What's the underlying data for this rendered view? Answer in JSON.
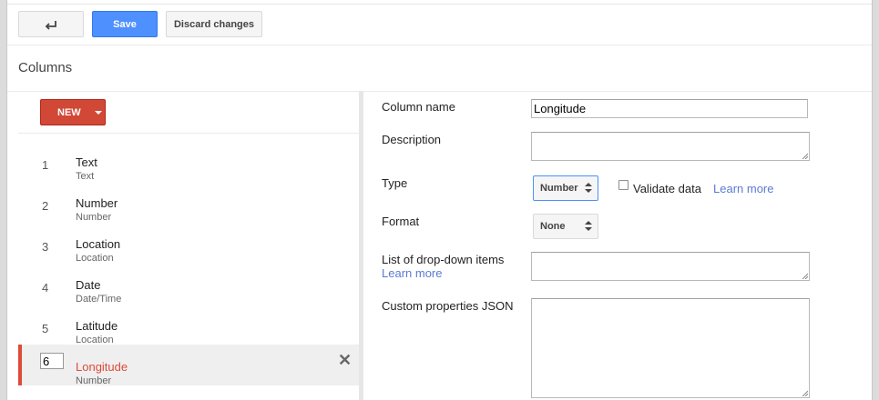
{
  "toolbar": {
    "back_icon": "back-arrow-icon",
    "save_label": "Save",
    "discard_label": "Discard changes"
  },
  "section": {
    "title": "Columns"
  },
  "new_button": {
    "label": "NEW",
    "icon": "dropdown-caret-icon"
  },
  "columns": [
    {
      "index": "1",
      "name": "Text",
      "type": "Text"
    },
    {
      "index": "2",
      "name": "Number",
      "type": "Number"
    },
    {
      "index": "3",
      "name": "Location",
      "type": "Location"
    },
    {
      "index": "4",
      "name": "Date",
      "type": "Date/Time"
    },
    {
      "index": "5",
      "name": "Latitude",
      "type": "Location"
    },
    {
      "index": "6",
      "name": "Longitude",
      "type": "Number",
      "selected": true
    }
  ],
  "delete_icon": "close-icon",
  "form": {
    "column_name_label": "Column name",
    "column_name_value": "Longitude",
    "description_label": "Description",
    "description_value": "",
    "type_label": "Type",
    "type_value": "Number",
    "validate_label": "Validate data",
    "validate_checked": false,
    "learn_more": "Learn more",
    "format_label": "Format",
    "format_value": "None",
    "dropdown_items_label": "List of drop-down items",
    "dropdown_items_learn_more": "Learn more",
    "dropdown_items_value": "",
    "custom_props_label": "Custom properties JSON",
    "custom_props_value": ""
  },
  "colors": {
    "primary_blue": "#4d90fe",
    "new_red": "#d14836",
    "selected_accent": "#dd4b39",
    "link": "#5a7bd3"
  }
}
